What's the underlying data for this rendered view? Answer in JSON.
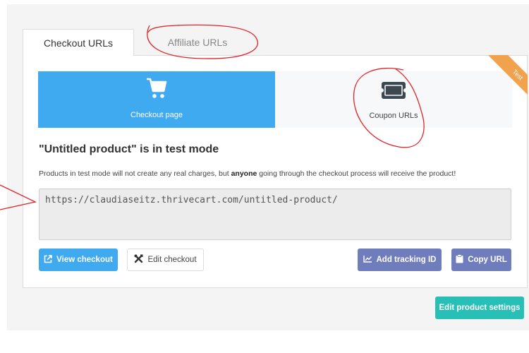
{
  "tabs": [
    {
      "label": "Checkout URLs",
      "active": true
    },
    {
      "label": "Affiliate URLs",
      "active": false
    }
  ],
  "ribbon": {
    "label": "Test",
    "color": "#f0a24c"
  },
  "cards": [
    {
      "label": "Checkout page",
      "icon": "cart-icon",
      "selected": true
    },
    {
      "label": "Coupon URLs",
      "icon": "coupon-ticket-icon",
      "selected": false
    }
  ],
  "heading": "\"Untitled product\" is in test mode",
  "description": {
    "before": "Products in test mode will not create any real charges, but ",
    "bold": "anyone",
    "after": " going through the checkout process will receive the product!"
  },
  "url_field": {
    "value": "https://claudiaseitz.thrivecart.com/untitled-product/"
  },
  "buttons": {
    "view_checkout": {
      "label": "View checkout",
      "icon": "external-link-icon"
    },
    "edit_checkout": {
      "label": "Edit checkout",
      "icon": "tools-icon"
    },
    "add_tracking": {
      "label": "Add tracking ID",
      "icon": "chart-line-icon"
    },
    "copy_url": {
      "label": "Copy URL",
      "icon": "clipboard-icon"
    },
    "edit_settings": {
      "label": "Edit product settings"
    }
  },
  "colors": {
    "primary_blue": "#3faaf0",
    "purple": "#6f7dbd",
    "teal": "#27bfb6",
    "annotation_red": "#e0242a"
  }
}
